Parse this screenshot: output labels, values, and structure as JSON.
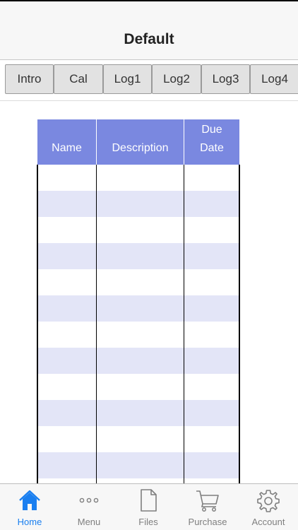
{
  "nav": {
    "title": "Default"
  },
  "tabs": [
    {
      "label": "Intro"
    },
    {
      "label": "Cal"
    },
    {
      "label": "Log1"
    },
    {
      "label": "Log2"
    },
    {
      "label": "Log3"
    },
    {
      "label": "Log4"
    }
  ],
  "table": {
    "columns": [
      {
        "lines": [
          "",
          "Name"
        ]
      },
      {
        "lines": [
          "",
          "Description"
        ]
      },
      {
        "lines": [
          "Due",
          "Date"
        ]
      }
    ],
    "header_color": "#7a88e0",
    "stripe_color": "#e3e5f7",
    "rows": [
      [
        "",
        "",
        ""
      ],
      [
        "",
        "",
        ""
      ],
      [
        "",
        "",
        ""
      ],
      [
        "",
        "",
        ""
      ],
      [
        "",
        "",
        ""
      ],
      [
        "",
        "",
        ""
      ],
      [
        "",
        "",
        ""
      ],
      [
        "",
        "",
        ""
      ],
      [
        "",
        "",
        ""
      ],
      [
        "",
        "",
        ""
      ],
      [
        "",
        "",
        ""
      ],
      [
        "",
        "",
        ""
      ]
    ]
  },
  "bottom_tabs": [
    {
      "label": "Home",
      "icon": "home-icon",
      "active": true
    },
    {
      "label": "Menu",
      "icon": "more-dots-icon",
      "active": false
    },
    {
      "label": "Files",
      "icon": "file-icon",
      "active": false
    },
    {
      "label": "Purchase",
      "icon": "cart-icon",
      "active": false
    },
    {
      "label": "Account",
      "icon": "gear-icon",
      "active": false
    }
  ],
  "colors": {
    "active_tab": "#1a7ff0",
    "inactive_tab": "#7f7f7f"
  }
}
